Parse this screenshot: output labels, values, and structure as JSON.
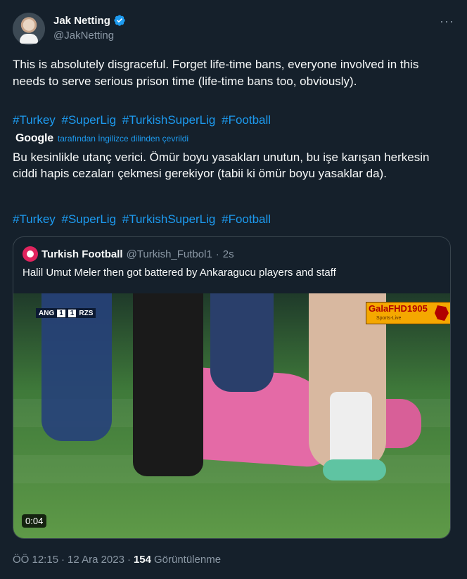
{
  "author": {
    "display_name": "Jak Netting",
    "handle": "@JakNetting"
  },
  "more_menu": "···",
  "tweet": {
    "text": "This is absolutely disgraceful. Forget life-time bans, everyone involved in this needs to serve serious prison time (life-time bans too, obviously).",
    "hashtags": [
      "#Turkey",
      "#SuperLig",
      "#TurkishSuperLig",
      "#Football"
    ]
  },
  "translation": {
    "provider": "Google",
    "note": "tarafından İngilizce dilinden çevrildi",
    "text": "Bu kesinlikle utanç verici. Ömür boyu yasakları unutun, bu işe karışan herkesin ciddi hapis cezaları çekmesi gerekiyor (tabii ki ömür boyu yasaklar da).",
    "hashtags": [
      "#Turkey",
      "#SuperLig",
      "#TurkishSuperLig",
      "#Football"
    ]
  },
  "quote": {
    "display_name": "Turkish Football",
    "handle": "@Turkish_Futbol1",
    "separator": "·",
    "time": "2s",
    "text": "Halil Umut Meler then got battered by Ankaragucu players and staff",
    "media": {
      "score_home": "ANG",
      "score_home_goals": "1",
      "score_away_goals": "1",
      "score_away": "RZS",
      "watermark_title": "GalaFHD1905",
      "watermark_sub": "Sports-Live",
      "duration": "0:04"
    }
  },
  "meta": {
    "time": "ÖÖ 12:15",
    "separator": "·",
    "date": "12 Ara 2023",
    "separator2": "·",
    "views_count": "154",
    "views_label": "Görüntülenme"
  },
  "colors": {
    "background": "#15202b",
    "link": "#1d9bf0",
    "secondary_text": "#8b98a5",
    "verified": "#1d9bf0"
  }
}
